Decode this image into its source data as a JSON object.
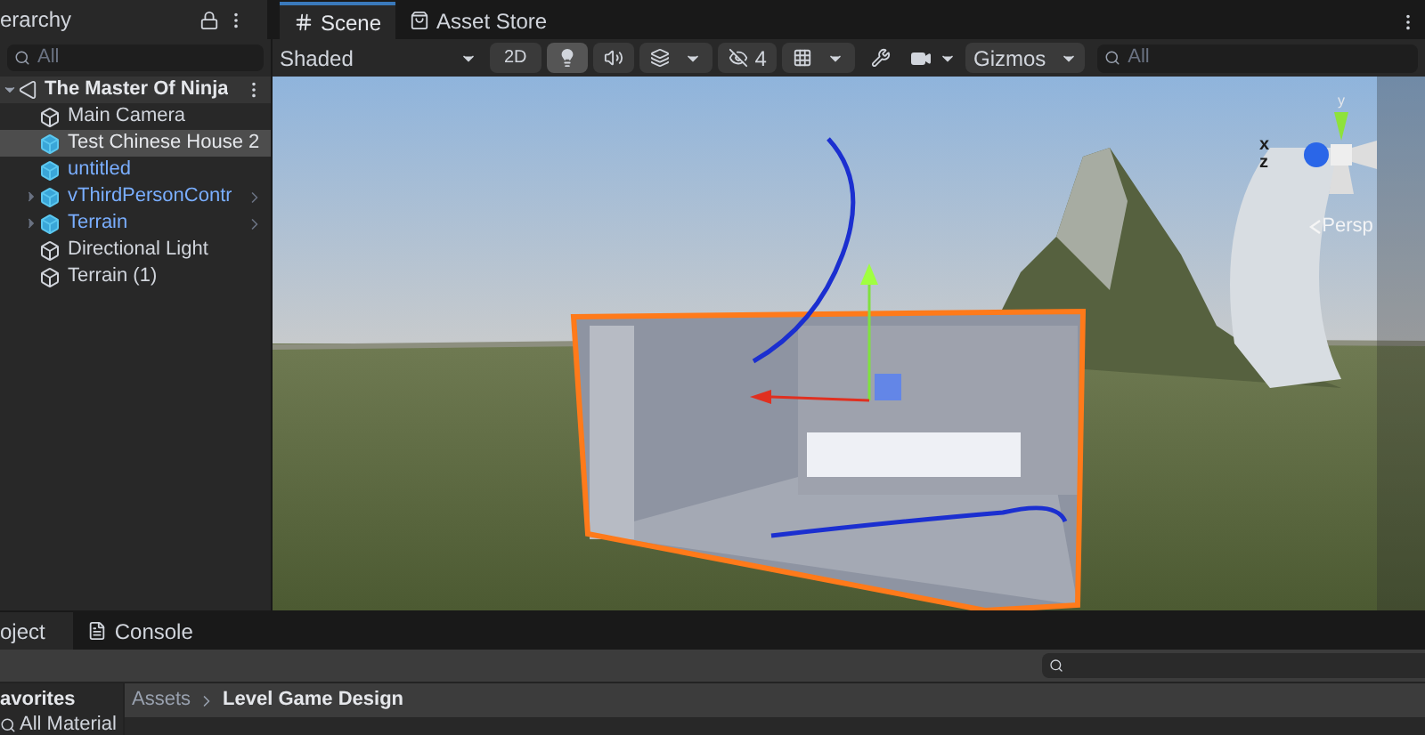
{
  "hierarchy": {
    "title": "erarchy",
    "search": {
      "placeholder": "All"
    },
    "tree": [
      {
        "label": "The Master Of Ninja",
        "kind": "scene",
        "expanded": true,
        "selected": false,
        "children": [
          {
            "label": "Main Camera",
            "kind": "object",
            "selected": false
          },
          {
            "label": "Test Chinese House 2",
            "kind": "prefab",
            "selected": true
          },
          {
            "label": "untitled",
            "kind": "prefab",
            "selected": false
          },
          {
            "label": "vThirdPersonContr",
            "kind": "prefab",
            "selected": false,
            "expanded": false
          },
          {
            "label": "Terrain",
            "kind": "prefab",
            "selected": false,
            "expanded": false
          },
          {
            "label": "Directional Light",
            "kind": "object",
            "selected": false
          },
          {
            "label": "Terrain (1)",
            "kind": "object",
            "selected": false
          }
        ]
      }
    ]
  },
  "scene": {
    "tabs": [
      {
        "label": "Scene",
        "selected": true
      },
      {
        "label": "Asset Store",
        "selected": false
      }
    ],
    "toolbar": {
      "shading": "Shaded",
      "mode_2d": {
        "label": "2D",
        "on": false
      },
      "lighting_on": true,
      "hidden_count": "4",
      "gizmos": "Gizmos",
      "search": {
        "placeholder": "All"
      }
    },
    "orientation_gizmo": {
      "axes": [
        "y",
        "x",
        "z"
      ],
      "projection": "Persp"
    }
  },
  "project": {
    "tabs": [
      {
        "label": "oject",
        "selected": true
      },
      {
        "label": "Console",
        "selected": false
      }
    ],
    "favorites": {
      "title": "avorites",
      "items": [
        "All Material"
      ]
    },
    "breadcrumb": [
      "Assets",
      "Level Game Design"
    ]
  }
}
